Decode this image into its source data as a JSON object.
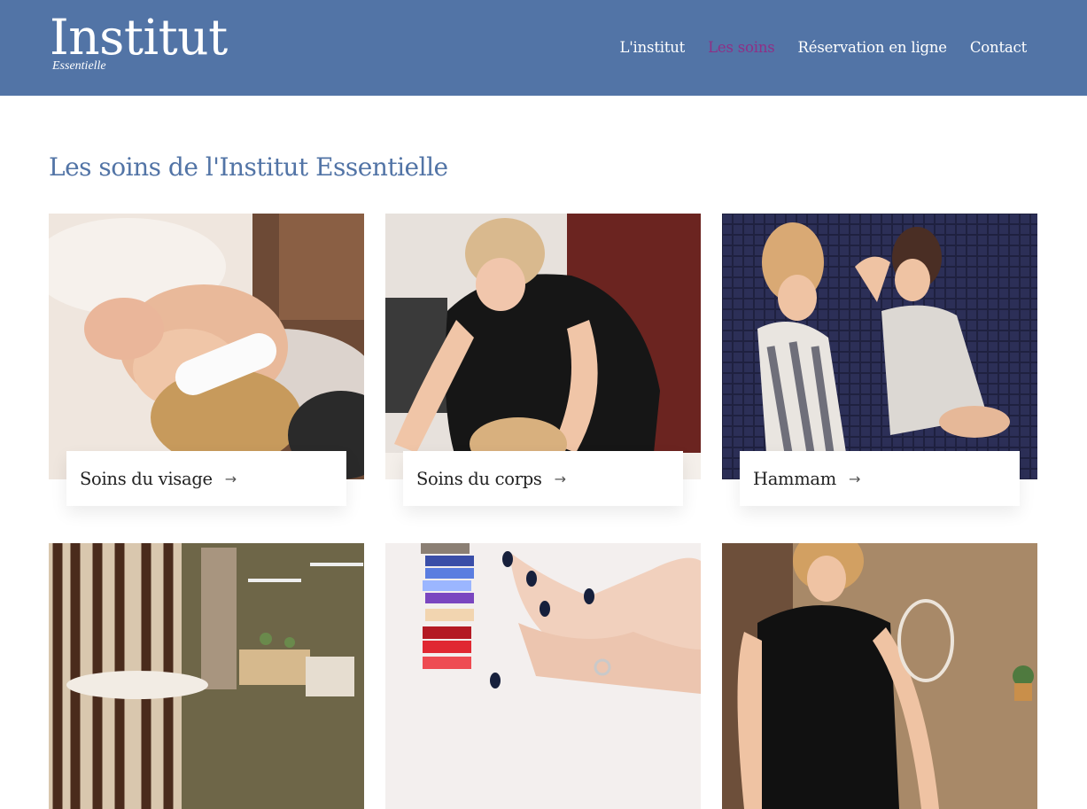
{
  "header": {
    "logo_main": "Institut",
    "logo_sub": "Essentielle",
    "nav": [
      {
        "label": "L'institut",
        "active": false
      },
      {
        "label": "Les soins",
        "active": true
      },
      {
        "label": "Réservation en ligne",
        "active": false
      },
      {
        "label": "Contact",
        "active": false
      }
    ]
  },
  "main": {
    "title": "Les soins de l'Institut Essentielle",
    "cards": [
      {
        "label": "Soins du visage",
        "arrow": "→",
        "image": "facial-care-photo"
      },
      {
        "label": "Soins du corps",
        "arrow": "→",
        "image": "body-massage-photo"
      },
      {
        "label": "Hammam",
        "arrow": "→",
        "image": "hammam-photo"
      },
      {
        "label": "",
        "image": "treatment-room-photo"
      },
      {
        "label": "",
        "image": "nail-polish-photo"
      },
      {
        "label": "",
        "image": "beautician-photo"
      }
    ]
  },
  "colors": {
    "header_bg": "#5274a6",
    "nav_active": "#8f2f86",
    "title": "#5274a6"
  }
}
